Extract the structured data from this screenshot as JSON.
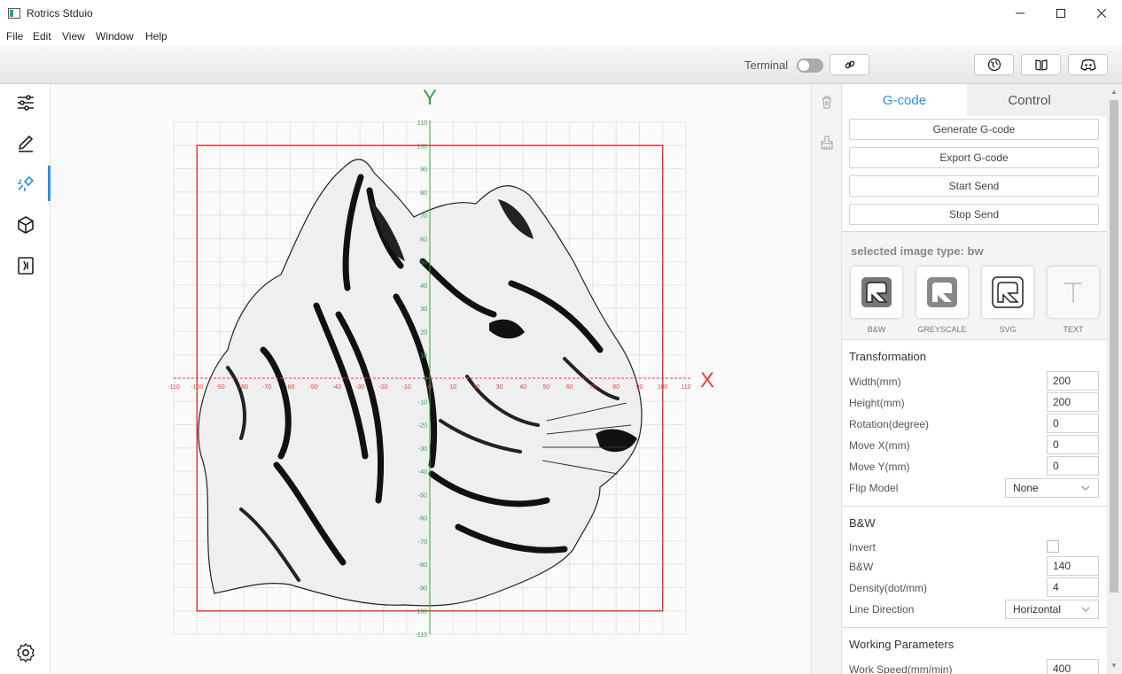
{
  "window": {
    "title": "Rotrics Stduio"
  },
  "menu": [
    "File",
    "Edit",
    "View",
    "Window",
    "Help"
  ],
  "toolbar": {
    "terminal_label": "Terminal",
    "terminal_on": false
  },
  "canvas": {
    "x_axis_label": "X",
    "y_axis_label": "Y",
    "x_ticks": [
      "-110",
      "-100",
      "-90",
      "-80",
      "-70",
      "-60",
      "-50",
      "-40",
      "-30",
      "-20",
      "-10",
      "0",
      "10",
      "20",
      "30",
      "40",
      "50",
      "60",
      "70",
      "80",
      "90",
      "100",
      "110"
    ],
    "y_ticks": [
      "110",
      "100",
      "90",
      "80",
      "70",
      "60",
      "50",
      "40",
      "30",
      "20",
      "10",
      "0",
      "-10",
      "-20",
      "-30",
      "-40",
      "-50",
      "-60",
      "-70",
      "-80",
      "-90",
      "-100",
      "-110"
    ],
    "axis_x_color": "#e0453c",
    "axis_y_color": "#3aa04a",
    "bounds_color": "#e03c3c"
  },
  "panel": {
    "tabs": [
      {
        "label": "G-code",
        "active": true
      },
      {
        "label": "Control",
        "active": false
      }
    ],
    "actions": [
      "Generate G-code",
      "Export G-code",
      "Start Send",
      "Stop Send"
    ],
    "selected_type_text": "selected image type: bw",
    "image_types": [
      {
        "label": "B&W",
        "icon": "bw-icon"
      },
      {
        "label": "GREYSCALE",
        "icon": "greyscale-icon"
      },
      {
        "label": "SVG",
        "icon": "svg-icon"
      },
      {
        "label": "TEXT",
        "icon": "text-icon"
      }
    ],
    "transformation": {
      "title": "Transformation",
      "width_label": "Width(mm)",
      "width": "200",
      "height_label": "Height(mm)",
      "height": "200",
      "rotation_label": "Rotation(degree)",
      "rotation": "0",
      "move_x_label": "Move X(mm)",
      "move_x": "0",
      "move_y_label": "Move Y(mm)",
      "move_y": "0",
      "flip_label": "Flip Model",
      "flip": "None"
    },
    "bw": {
      "title": "B&W",
      "invert_label": "Invert",
      "invert": false,
      "bw_label": "B&W",
      "bw_value": "140",
      "density_label": "Density(dot/mm)",
      "density": "4",
      "direction_label": "Line Direction",
      "direction": "Horizontal"
    },
    "working": {
      "title": "Working Parameters",
      "speed_label": "Work Speed(mm/min)",
      "speed": "400"
    }
  },
  "accent_color": "#2b90e8"
}
